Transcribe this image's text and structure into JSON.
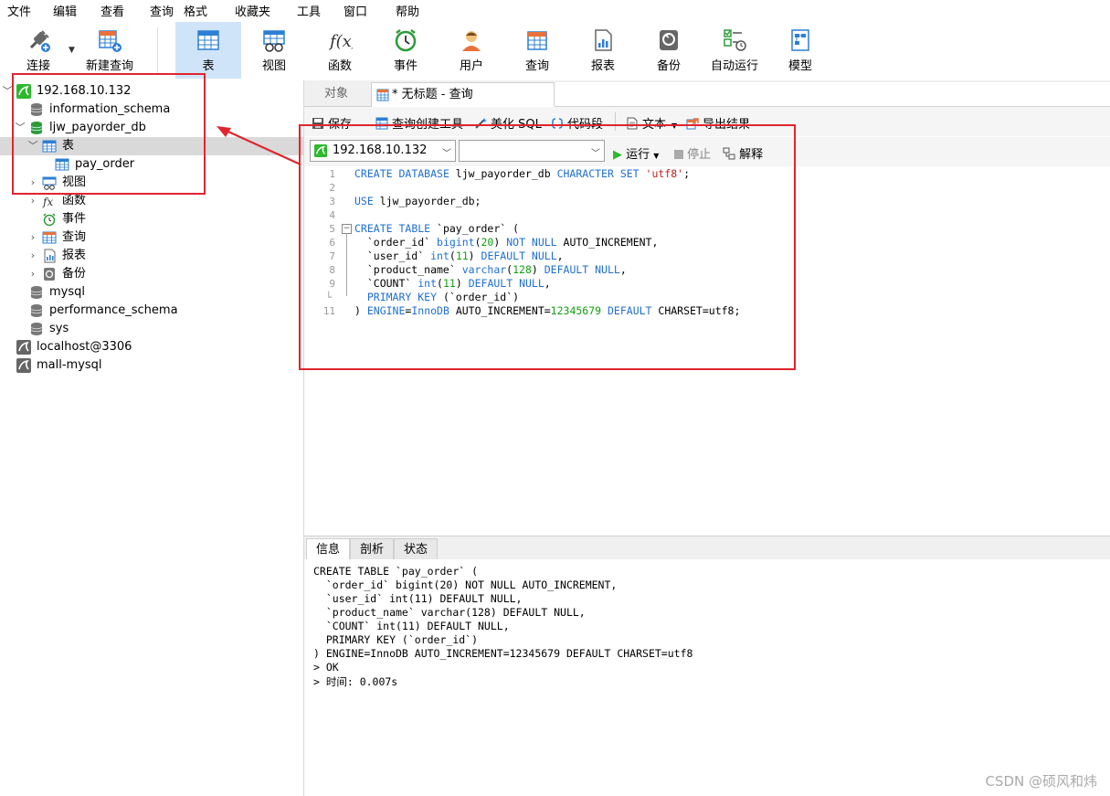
{
  "menu": [
    "文件",
    "编辑",
    "查看",
    "查询",
    "格式",
    "收藏夹",
    "工具",
    "窗口",
    "帮助"
  ],
  "toolbar": {
    "connect": "连接",
    "new_query": "新建查询",
    "table": "表",
    "view": "视图",
    "function": "函数",
    "event": "事件",
    "user": "用户",
    "query": "查询",
    "report": "报表",
    "backup": "备份",
    "auto_run": "自动运行",
    "model": "模型"
  },
  "tree": {
    "server": "192.168.10.132",
    "dbs": {
      "information_schema": "information_schema",
      "ljw_payorder_db": "ljw_payorder_db",
      "mysql": "mysql",
      "performance_schema": "performance_schema",
      "sys": "sys"
    },
    "tables_folder": "表",
    "table_pay_order": "pay_order",
    "views": "视图",
    "functions": "函数",
    "events": "事件",
    "queries": "查询",
    "reports": "报表",
    "backups": "备份",
    "conn_localhost": "localhost@3306",
    "conn_mall": "mall-mysql"
  },
  "tabs": {
    "objects": "对象",
    "query": "* 无标题 - 查询"
  },
  "editor_toolbar": {
    "save": "保存",
    "query_builder": "查询创建工具",
    "beautify": "美化 SQL",
    "snippet": "代码段",
    "text": "文本",
    "export": "导出结果"
  },
  "conn_bar": {
    "connection": "192.168.10.132",
    "database": "",
    "run": "运行",
    "stop": "停止",
    "explain": "解释"
  },
  "code_lines": [
    "CREATE DATABASE ljw_payorder_db CHARACTER SET 'utf8';",
    "",
    "USE ljw_payorder_db;",
    "",
    "CREATE TABLE `pay_order` (",
    "  `order_id` bigint(20) NOT NULL AUTO_INCREMENT,",
    "  `user_id` int(11) DEFAULT NULL,",
    "  `product_name` varchar(128) DEFAULT NULL,",
    "  `COUNT` int(11) DEFAULT NULL,",
    "  PRIMARY KEY (`order_id`)",
    ") ENGINE=InnoDB AUTO_INCREMENT=12345679 DEFAULT CHARSET=utf8;"
  ],
  "bottom_tabs": [
    "信息",
    "剖析",
    "状态"
  ],
  "output_lines": [
    "CREATE TABLE `pay_order` (",
    "  `order_id` bigint(20) NOT NULL AUTO_INCREMENT,",
    "  `user_id` int(11) DEFAULT NULL,",
    "  `product_name` varchar(128) DEFAULT NULL,",
    "  `COUNT` int(11) DEFAULT NULL,",
    "  PRIMARY KEY (`order_id`)",
    ") ENGINE=InnoDB AUTO_INCREMENT=12345679 DEFAULT CHARSET=utf8",
    "> OK",
    "> 时间: 0.007s"
  ],
  "watermark": "CSDN @硕风和炜",
  "colors": {
    "annotation": "#e0252e",
    "selection": "#d9d9d9",
    "toolbar_active": "#cfe4f8",
    "keyword": "#1f6fd1",
    "number": "#11a011",
    "string": "#c02020"
  }
}
